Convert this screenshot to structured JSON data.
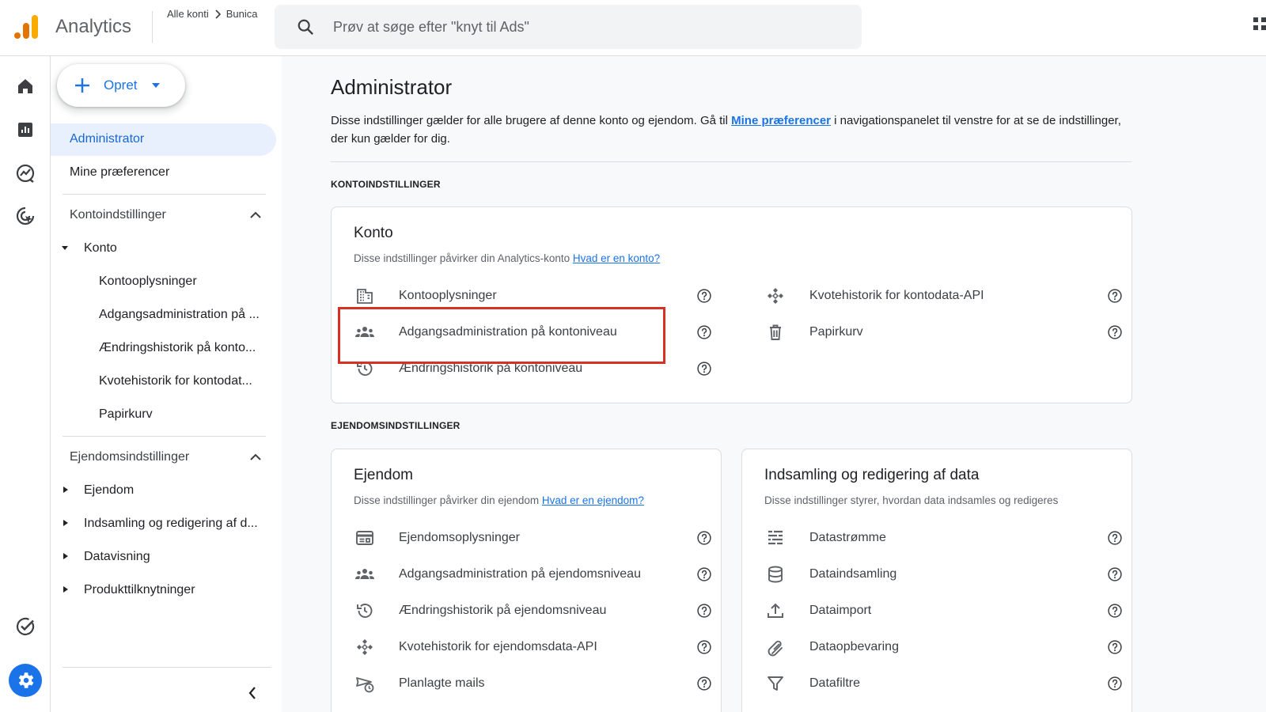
{
  "header": {
    "app_title": "Analytics",
    "breadcrumb": [
      "Alle konti",
      "Bunica"
    ],
    "search_placeholder": "Prøv at søge efter \"knyt til Ads\""
  },
  "rail": {
    "items": [
      "home-icon",
      "reports-icon",
      "explore-icon",
      "advertising-icon",
      "insights-icon",
      "admin-gear-icon"
    ]
  },
  "sidebar": {
    "create_label": "Opret",
    "items": [
      "Administrator",
      "Mine præferencer"
    ],
    "account_section": {
      "title": "Kontoindstillinger",
      "group": "Konto",
      "children": [
        "Kontooplysninger",
        "Adgangsadministration på ...",
        "Ændringshistorik på konto...",
        "Kvotehistorik for kontodat...",
        "Papirkurv"
      ]
    },
    "property_section": {
      "title": "Ejendomsindstillinger",
      "groups": [
        "Ejendom",
        "Indsamling og redigering af d...",
        "Datavisning",
        "Produkttilknytninger"
      ]
    }
  },
  "main": {
    "title": "Administrator",
    "desc_before": "Disse indstillinger gælder for alle brugere af denne konto og ejendom. Gå til ",
    "desc_link": "Mine præferencer",
    "desc_after": " i navigationspanelet til venstre for at se de indstillinger, der kun gælder for dig.",
    "account_label": "KONTOINDSTILLINGER",
    "property_label": "EJENDOMSINDSTILLINGER",
    "account_card": {
      "title": "Konto",
      "subtitle": "Disse indstillinger påvirker din Analytics-konto ",
      "subtitle_link": "Hvad er en konto?",
      "left_items": [
        "Kontooplysninger",
        "Adgangsadministration på kontoniveau",
        "Ændringshistorik på kontoniveau"
      ],
      "right_items": [
        "Kvotehistorik for kontodata-API",
        "Papirkurv"
      ]
    },
    "property_card": {
      "title": "Ejendom",
      "subtitle": "Disse indstillinger påvirker din ejendom ",
      "subtitle_link": "Hvad er en ejendom?",
      "items": [
        "Ejendomsoplysninger",
        "Adgangsadministration på ejendomsniveau",
        "Ændringshistorik på ejendomsniveau",
        "Kvotehistorik for ejendomsdata-API",
        "Planlagte mails"
      ]
    },
    "data_card": {
      "title": "Indsamling og redigering af data",
      "subtitle": "Disse indstillinger styrer, hvordan data indsamles og redigeres",
      "items": [
        "Datastrømme",
        "Dataindsamling",
        "Dataimport",
        "Dataopbevaring",
        "Datafiltre"
      ]
    }
  },
  "colors": {
    "accent": "#1a73e8",
    "highlight": "#d93025",
    "logo_orange": "#f9ab00",
    "logo_dark_orange": "#e37400"
  }
}
